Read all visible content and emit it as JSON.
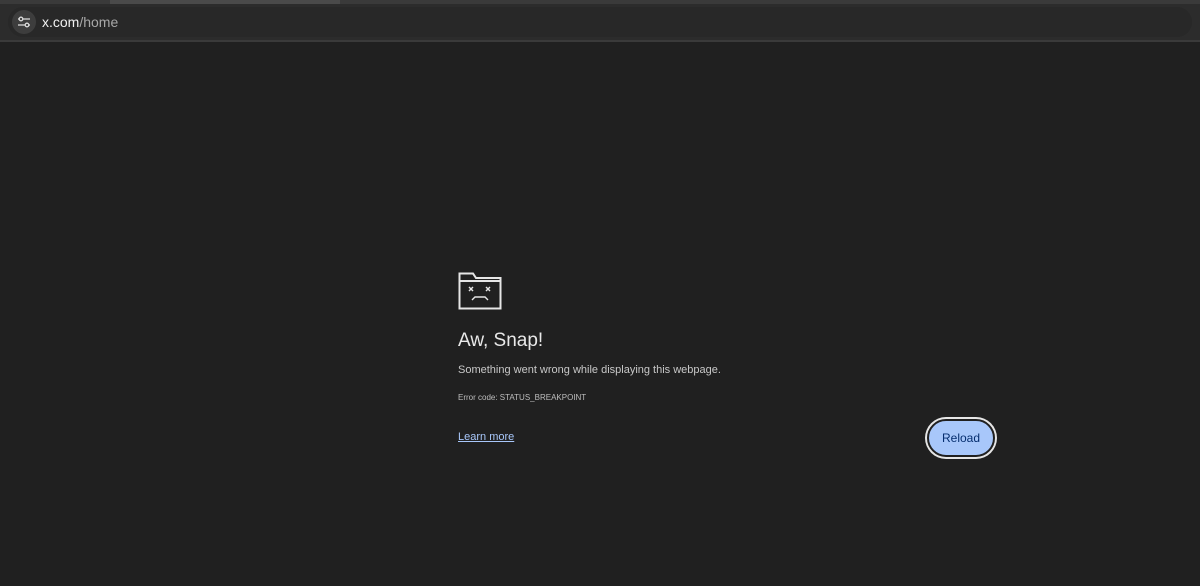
{
  "browser": {
    "url_host": "x.com",
    "url_path": "/home",
    "site_info_icon": "tune-icon"
  },
  "error_page": {
    "icon": "sad-tab-icon",
    "title": "Aw, Snap!",
    "description": "Something went wrong while displaying this webpage.",
    "error_code": "Error code: STATUS_BREAKPOINT",
    "learn_more_label": "Learn more",
    "reload_label": "Reload"
  },
  "colors": {
    "background": "#202020",
    "link": "#a8c7fa",
    "button_bg": "#a8c7fa",
    "button_text": "#062e6f"
  }
}
